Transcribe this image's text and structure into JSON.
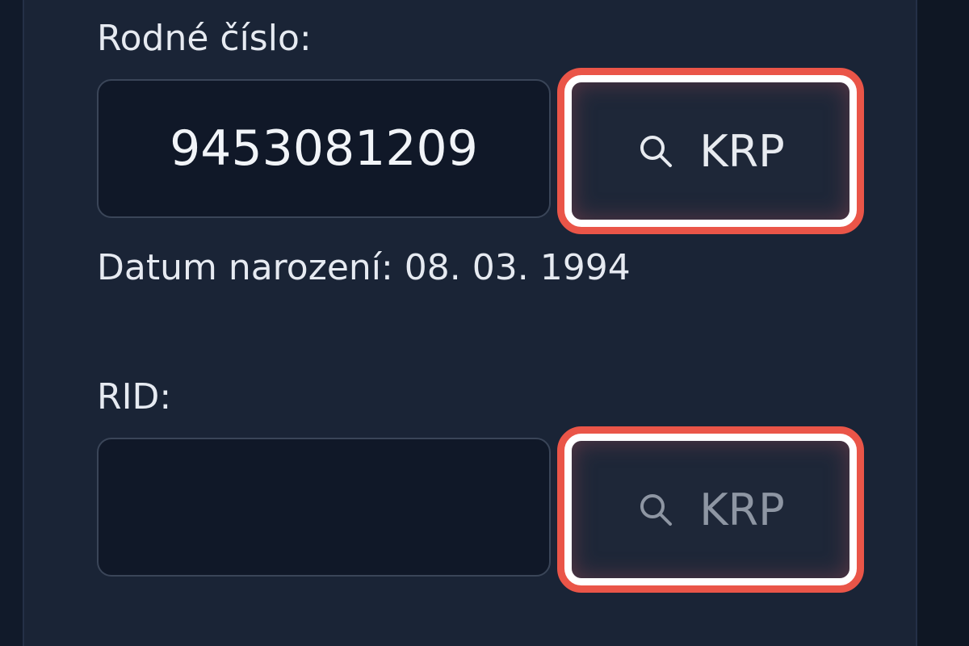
{
  "form": {
    "rodne_cislo": {
      "label": "Rodné číslo:",
      "value": "9453081209",
      "button_label": "KRP",
      "button_icon": "search-icon"
    },
    "birth_date_text": "Datum narození: 08. 03. 1994",
    "rid": {
      "label": "RID:",
      "value": "",
      "button_label": "KRP",
      "button_icon": "search-icon"
    }
  },
  "colors": {
    "background": "#111a2a",
    "panel": "#1a2436",
    "highlight_border": "#ea5548",
    "text": "#e6eaf1"
  }
}
